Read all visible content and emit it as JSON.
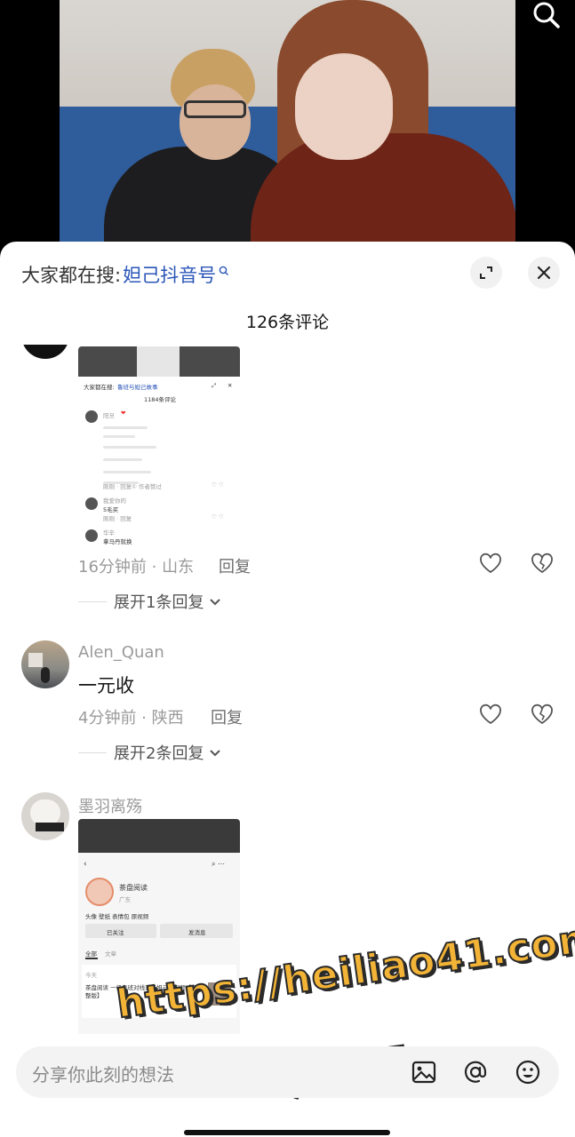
{
  "header": {
    "suggest_prefix": "大家都在搜:",
    "suggest_keyword": "妲己抖音号",
    "comment_count": "126条评论"
  },
  "comments": [
    {
      "meta": "16分钟前 · 山东",
      "reply_label": "回复",
      "expand_label": "展开1条回复",
      "image": {
        "suggest_prefix": "大家都在搜:",
        "suggest_keyword": "鲁班与妲己故事",
        "count": "1184条评论",
        "user1": "阳旦",
        "user2": "我爱你的",
        "text2": "5毛买",
        "user3": "华辛",
        "text3": "拿马丹就换",
        "sub_reply": "回复",
        "sub_time1": "刚刚 · 回复",
        "sub_time2": "刚刚 · 回复",
        "sub_author": "① 作者赞过"
      }
    },
    {
      "username": "Alen_Quan",
      "text": "一元收",
      "meta": "4分钟前 · 陕西",
      "reply_label": "回复",
      "expand_label": "展开2条回复"
    },
    {
      "username": "墨羽离殇",
      "image": {
        "account_name": "茶盘阅读",
        "location": "广东",
        "tags": "头像 壁纸 表情包 原视频",
        "followed": "已关注",
        "message": "发消息",
        "tab_all": "全部",
        "tab_article": "文章",
        "date": "今天",
        "post_title": "茶盘阅读 一级鲁班对线满级妲己原视频【完整版】"
      }
    }
  ],
  "input": {
    "placeholder": "分享你此刻的想法"
  },
  "watermark": {
    "line1": "https://heiliao41.com",
    "line2": "黑料网"
  },
  "colors": {
    "accent": "#2a56b8",
    "watermark": "#f2b336"
  }
}
